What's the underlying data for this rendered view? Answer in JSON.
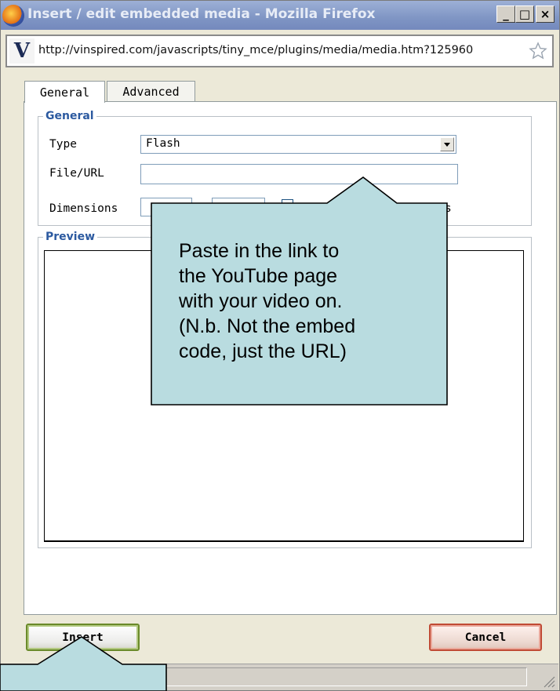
{
  "window": {
    "title": "Insert / edit embedded media - Mozilla Firefox",
    "minimize_label": "_",
    "maximize_label": "□",
    "close_label": "×"
  },
  "address_bar": {
    "site_icon_letter": "V",
    "url": "http://vinspired.com/javascripts/tiny_mce/plugins/media/media.htm?125960"
  },
  "tabs": [
    {
      "label": "General",
      "active": true
    },
    {
      "label": "Advanced",
      "active": false
    }
  ],
  "general_section": {
    "legend": "General",
    "type_label": "Type",
    "type_value": "Flash",
    "file_url_label": "File/URL",
    "file_url_value": "",
    "dimensions_label": "Dimensions",
    "dimensions_width": "",
    "dimensions_height": "",
    "constrain_suffix": "s"
  },
  "preview_section": {
    "legend": "Preview"
  },
  "buttons": {
    "insert": "Insert",
    "cancel": "Cancel"
  },
  "callout": {
    "lines": [
      "Paste in the link to",
      "the YouTube page",
      "with your video on.",
      "(N.b. Not the embed",
      "code, just the URL)"
    ],
    "color": "#b9dce0"
  },
  "colors": {
    "titlebar": "#8198c8",
    "legend_text": "#2c5aa0",
    "insert_border": "#6a8a2a",
    "cancel_border": "#c04a34"
  }
}
